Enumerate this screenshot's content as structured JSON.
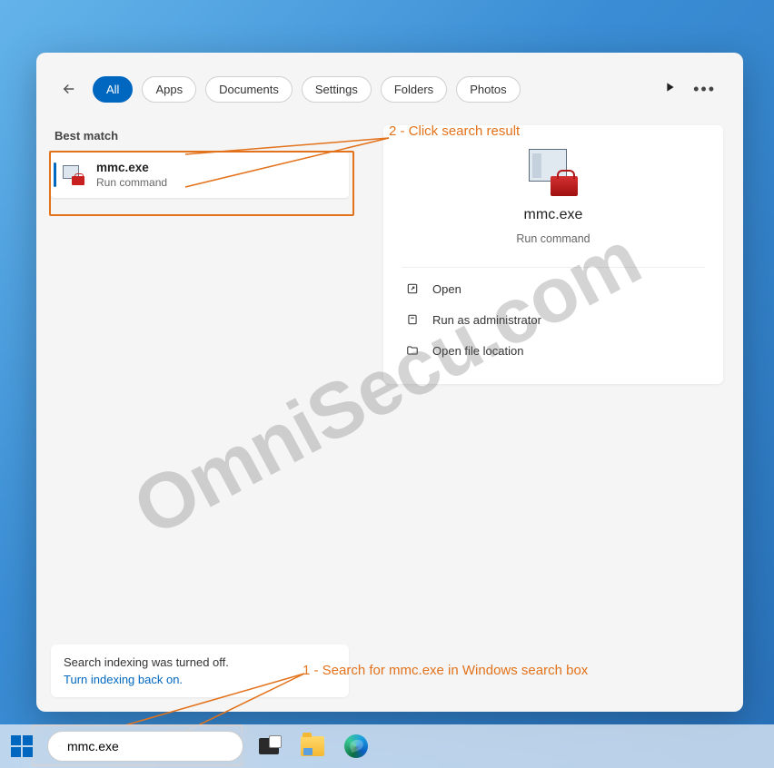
{
  "tabs": {
    "all": "All",
    "apps": "Apps",
    "documents": "Documents",
    "settings": "Settings",
    "folders": "Folders",
    "photos": "Photos"
  },
  "section_header": "Best match",
  "result": {
    "title": "mmc.exe",
    "subtitle": "Run command"
  },
  "detail": {
    "title": "mmc.exe",
    "subtitle": "Run command",
    "actions": {
      "open": "Open",
      "run_admin": "Run as administrator",
      "open_location": "Open file location"
    }
  },
  "indexing": {
    "message": "Search indexing was turned off.",
    "link": "Turn indexing back on."
  },
  "searchbox": {
    "value": "mmc.exe"
  },
  "annotations": {
    "step1": "1 - Search for mmc.exe in Windows search box",
    "step2": "2 - Click search result"
  },
  "watermark": "OmniSecu.com"
}
